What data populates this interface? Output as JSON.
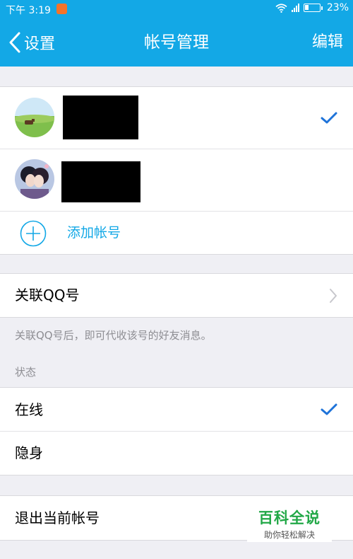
{
  "status_bar": {
    "time": "下午 3:19",
    "battery": "23%"
  },
  "navbar": {
    "back_label": "设置",
    "title": "帐号管理",
    "edit_label": "编辑"
  },
  "accounts": {
    "add_label": "添加帐号"
  },
  "link_qq": {
    "label": "关联QQ号",
    "description": "关联QQ号后，即可代收该号的好友消息。"
  },
  "status_section": {
    "header": "状态",
    "options": [
      {
        "label": "在线",
        "selected": true
      },
      {
        "label": "隐身",
        "selected": false
      }
    ]
  },
  "logout": {
    "label": "退出当前帐号"
  },
  "watermark": {
    "brand": "百科全说",
    "slogan": "助你轻松解决"
  },
  "colors": {
    "accent": "#13a8e6",
    "background": "#efeff4",
    "check": "#1e73d9",
    "watermark_green": "#22a847"
  }
}
